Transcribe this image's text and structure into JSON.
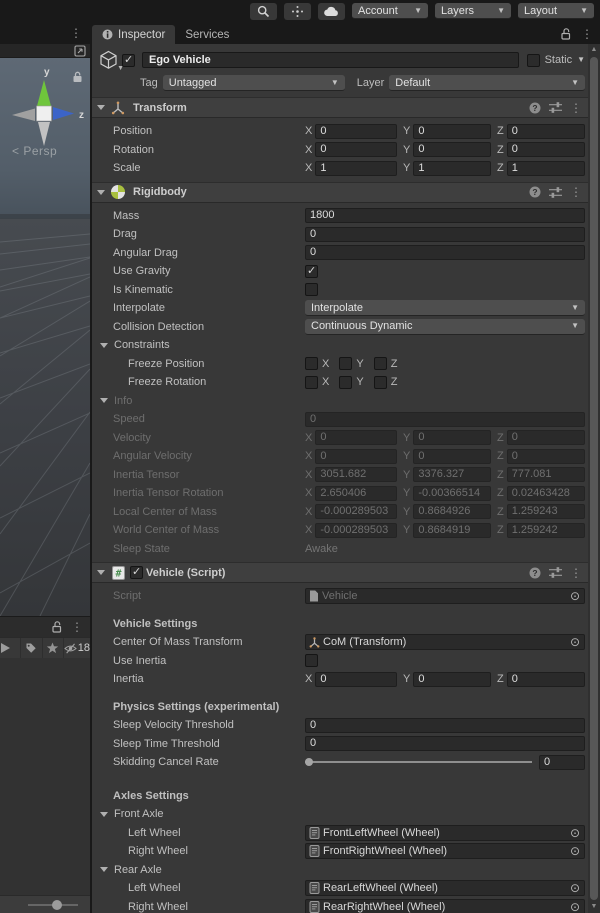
{
  "toolbar": {
    "account_label": "Account",
    "layers_label": "Layers",
    "layout_label": "Layout"
  },
  "panel_tabs": {
    "inspector": "Inspector",
    "services": "Services"
  },
  "scene_view": {
    "persp_label": "< Persp",
    "axis_y_label": "y",
    "axis_z_label": "z",
    "hidden_count": "18"
  },
  "colors": {
    "axis_y": "#6fc53c",
    "axis_z": "#3c64c8",
    "rigidbody_green": "#a8bf3f",
    "script_hash_green": "#4a8e50"
  },
  "axes": [
    "X",
    "Y",
    "Z"
  ],
  "game_object": {
    "name": "Ego Vehicle",
    "static_label": "Static",
    "tag_label": "Tag",
    "tag_value": "Untagged",
    "layer_label": "Layer",
    "layer_value": "Default"
  },
  "components": [
    {
      "title": "Transform",
      "icon": "transform",
      "rows": [
        {
          "t": "xyz",
          "label": "Position",
          "x": "0",
          "y": "0",
          "z": "0"
        },
        {
          "t": "xyz",
          "label": "Rotation",
          "x": "0",
          "y": "0",
          "z": "0"
        },
        {
          "t": "xyz",
          "label": "Scale",
          "x": "1",
          "y": "1",
          "z": "1"
        }
      ]
    },
    {
      "title": "Rigidbody",
      "icon": "rigidbody",
      "rows": [
        {
          "t": "field",
          "label": "Mass",
          "value": "1800"
        },
        {
          "t": "field",
          "label": "Drag",
          "value": "0"
        },
        {
          "t": "field",
          "label": "Angular Drag",
          "value": "0"
        },
        {
          "t": "check",
          "label": "Use Gravity",
          "on": true
        },
        {
          "t": "check",
          "label": "Is Kinematic",
          "on": false
        },
        {
          "t": "drop",
          "label": "Interpolate",
          "value": "Interpolate"
        },
        {
          "t": "drop",
          "label": "Collision Detection",
          "value": "Continuous Dynamic"
        },
        {
          "t": "fold",
          "label": "Constraints"
        },
        {
          "t": "check3",
          "label": "Freeze Position",
          "ind": true
        },
        {
          "t": "check3",
          "label": "Freeze Rotation",
          "ind": true
        },
        {
          "t": "fold",
          "label": "Info",
          "dis": true
        },
        {
          "t": "field",
          "label": "Speed",
          "value": "0",
          "dis": true
        },
        {
          "t": "xyz",
          "label": "Velocity",
          "x": "0",
          "y": "0",
          "z": "0",
          "dis": true
        },
        {
          "t": "xyz",
          "label": "Angular Velocity",
          "x": "0",
          "y": "0",
          "z": "0",
          "dis": true
        },
        {
          "t": "xyz",
          "label": "Inertia Tensor",
          "x": "3051.682",
          "y": "3376.327",
          "z": "777.081",
          "dis": true
        },
        {
          "t": "xyz",
          "label": "Inertia Tensor Rotation",
          "x": "2.650406",
          "y": "-0.00366514",
          "z": "0.02463428",
          "dis": true
        },
        {
          "t": "xyz",
          "label": "Local Center of Mass",
          "x": "-0.000289503",
          "y": "0.8684926",
          "z": "1.259243",
          "dis": true
        },
        {
          "t": "xyz",
          "label": "World Center of Mass",
          "x": "-0.000289503",
          "y": "0.8684919",
          "z": "1.259242",
          "dis": true
        },
        {
          "t": "text",
          "label": "Sleep State",
          "value": "Awake",
          "dis": true
        }
      ]
    },
    {
      "title": "Vehicle (Script)",
      "icon": "script",
      "enabled": true,
      "rows": [
        {
          "t": "obj",
          "label": "Script",
          "value": "Vehicle",
          "icon": "page",
          "dis": true
        },
        {
          "t": "gap"
        },
        {
          "t": "head",
          "label": "Vehicle Settings"
        },
        {
          "t": "obj",
          "label": "Center Of Mass Transform",
          "value": "CoM (Transform)",
          "icon": "tripod"
        },
        {
          "t": "check",
          "label": "Use Inertia",
          "on": false
        },
        {
          "t": "xyz",
          "label": "Inertia",
          "x": "0",
          "y": "0",
          "z": "0"
        },
        {
          "t": "gap"
        },
        {
          "t": "head",
          "label": "Physics Settings (experimental)"
        },
        {
          "t": "field",
          "label": "Sleep Velocity Threshold",
          "value": "0"
        },
        {
          "t": "field",
          "label": "Sleep Time Threshold",
          "value": "0"
        },
        {
          "t": "slider",
          "label": "Skidding Cancel Rate",
          "value": "0"
        },
        {
          "t": "gap2"
        },
        {
          "t": "head",
          "label": "Axles Settings"
        },
        {
          "t": "fold",
          "label": "Front Axle"
        },
        {
          "t": "obj",
          "label": "Left Wheel",
          "value": "FrontLeftWheel (Wheel)",
          "icon": "pagedark",
          "ind": true
        },
        {
          "t": "obj",
          "label": "Right Wheel",
          "value": "FrontRightWheel (Wheel)",
          "icon": "pagedark",
          "ind": true
        },
        {
          "t": "fold",
          "label": "Rear Axle"
        },
        {
          "t": "obj",
          "label": "Left Wheel",
          "value": "RearLeftWheel (Wheel)",
          "icon": "pagedark",
          "ind": true
        },
        {
          "t": "obj",
          "label": "Right Wheel",
          "value": "RearRightWheel (Wheel)",
          "icon": "pagedark",
          "ind": true
        }
      ]
    }
  ]
}
